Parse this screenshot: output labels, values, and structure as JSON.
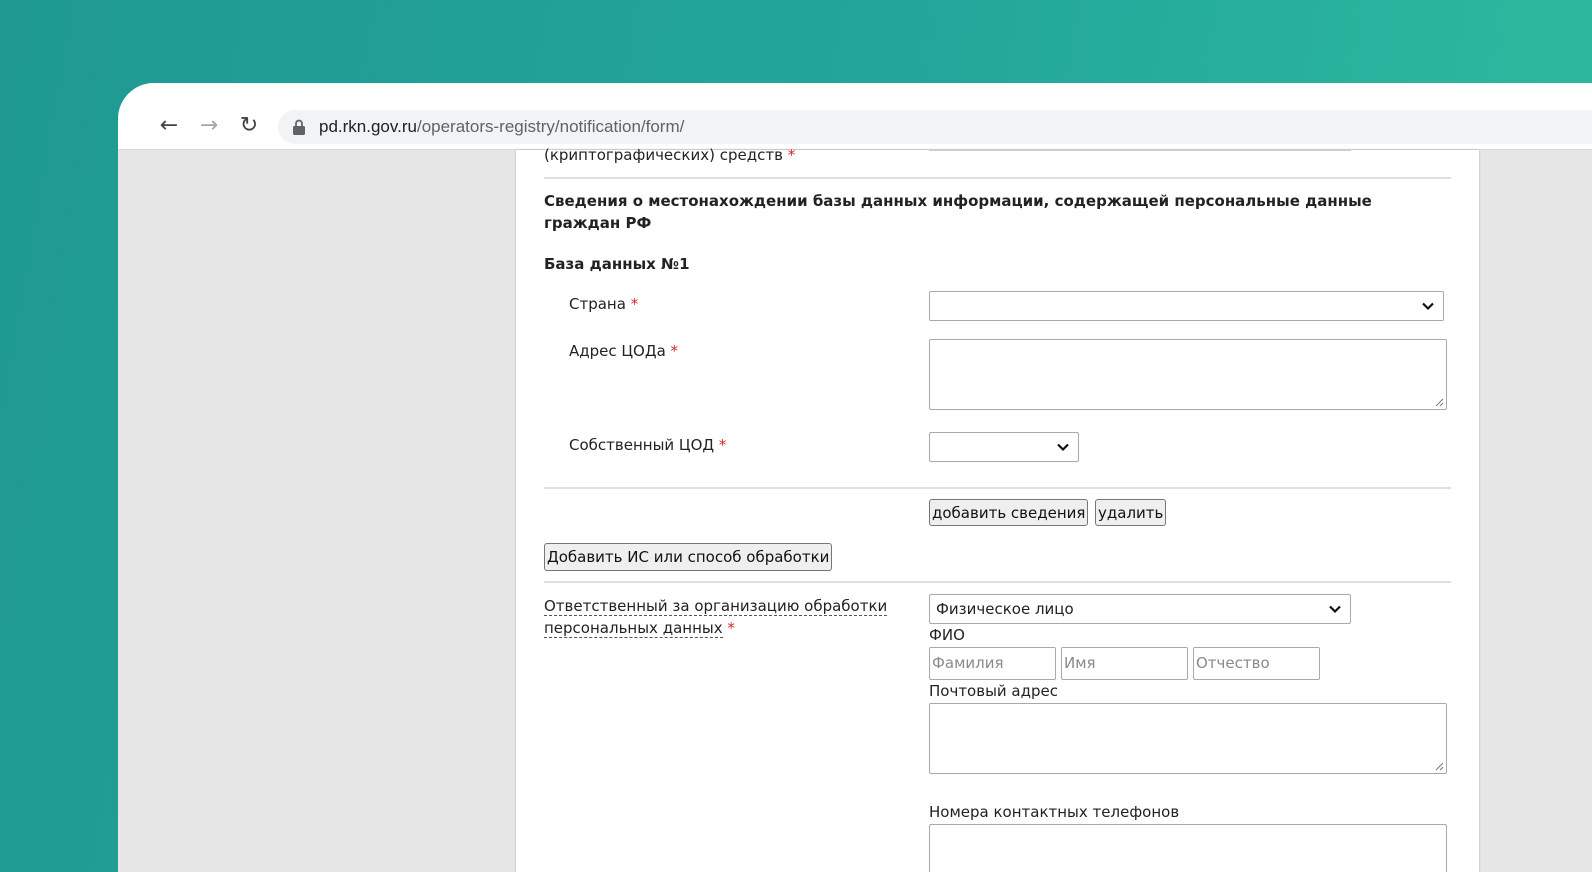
{
  "browser": {
    "url_host": "pd.rkn.gov.ru",
    "url_path": "/operators-registry/notification/form/"
  },
  "form": {
    "cut_label": "(криптографических) средств",
    "section_title_line1": "Сведения о местонахождении базы данных информации, содержащей персональные данные",
    "section_title_line2": "граждан РФ",
    "db_title": "База данных №1",
    "country_label": "Страна",
    "country_value": "",
    "cod_address_label": "Адрес ЦОДа",
    "cod_address_value": "",
    "own_cod_label": "Собственный ЦОД",
    "own_cod_value": "",
    "add_info_button": "добавить сведения",
    "delete_button": "удалить",
    "add_is_button": "Добавить ИС или способ обработки",
    "responsible_label_line1": "Ответственный за организацию обработки",
    "responsible_label_line2": "персональных данных",
    "responsible_value": "Физическое лицо",
    "fio_label": "ФИО",
    "surname_placeholder": "Фамилия",
    "name_placeholder": "Имя",
    "patronymic_placeholder": "Отчество",
    "postal_label": "Почтовый адрес",
    "postal_value": "",
    "phones_label": "Номера контактных телефонов",
    "required_mark": "*"
  },
  "colors": {
    "required": "#d9252a",
    "background_gradient_start": "#1f9992",
    "background_gradient_end": "#2ebc9f"
  }
}
